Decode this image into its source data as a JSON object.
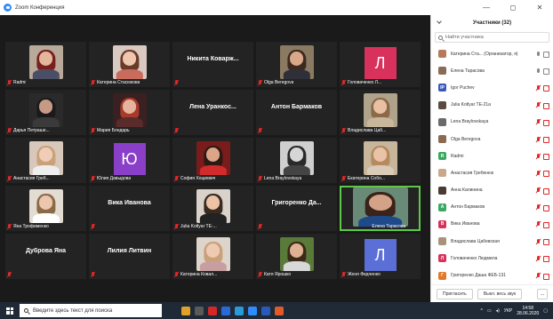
{
  "window": {
    "title": "Zoom Конференция",
    "controls": {
      "minimize": "—",
      "maximize": "◻",
      "close": "✕"
    }
  },
  "gallery": {
    "tiles": [
      {
        "name": "Radmi",
        "kind": "photo",
        "bg": "#b8a99a",
        "skin": "#e3b79b",
        "hair": "#7a1f1f",
        "torso": "#4a4f66"
      },
      {
        "name": "Катерина Стасюкова",
        "kind": "photo",
        "bg": "#d9c9c0",
        "skin": "#efc7b0",
        "hair": "#6b3b2a",
        "torso": "#c96b5d"
      },
      {
        "name": "Никита Коварж...",
        "kind": "name"
      },
      {
        "name": "Olga Beregova",
        "kind": "photo",
        "bg": "#8a7a62",
        "skin": "#d9a889",
        "hair": "#3d2a1f",
        "torso": "#2f2f3a"
      },
      {
        "name": "Головаченко Л...",
        "kind": "letter",
        "letter": "Л",
        "color": "#d8315b"
      },
      {
        "name": "Дарья Петраше...",
        "kind": "photo",
        "bg": "#2a2a2a",
        "skin": "#c79a86",
        "hair": "#1a1a1a",
        "torso": "#3a3a3a"
      },
      {
        "name": "Мария Бондарь",
        "kind": "photo",
        "bg": "#3a2020",
        "skin": "#e6b49e",
        "hair": "#a83a2a",
        "torso": "#5a2b2b"
      },
      {
        "name": "Лена Уранкос...",
        "kind": "name"
      },
      {
        "name": "Антон Бармаков",
        "kind": "name"
      },
      {
        "name": "Владислава Цаб...",
        "kind": "photo",
        "bg": "#b0a38c",
        "skin": "#e8c0a4",
        "hair": "#8c6a48",
        "torso": "#c9b79c"
      },
      {
        "name": "Анастасия Греб...",
        "kind": "photo",
        "bg": "#d8c8bc",
        "skin": "#f0cdb8",
        "hair": "#caa27a",
        "torso": "#eeeeee"
      },
      {
        "name": "Юлия Давыдова",
        "kind": "letter",
        "letter": "Ю",
        "color": "#8a3fc9"
      },
      {
        "name": "София Хоцкевич",
        "kind": "photo",
        "bg": "#7a1c1c",
        "skin": "#dca488",
        "hair": "#2a1a14",
        "torso": "#d22b2b"
      },
      {
        "name": "Lena Braylovskaya",
        "kind": "photo",
        "bg": "#cfcfcf",
        "skin": "#d6d6d6",
        "hair": "#2a2a2a",
        "torso": "#444444"
      },
      {
        "name": "Екатерина Собо...",
        "kind": "photo",
        "bg": "#c7b59c",
        "skin": "#e9c3a8",
        "hair": "#b58a5c",
        "torso": "#d9cbb8"
      },
      {
        "name": "Яна Трофименко",
        "kind": "photo",
        "bg": "#e2dcd2",
        "skin": "#ecc7ad",
        "hair": "#8b6a4a",
        "torso": "#ffffff"
      },
      {
        "name": "Вика Иванова",
        "kind": "name"
      },
      {
        "name": "Julia Kotlyar TE-...",
        "kind": "photo",
        "bg": "#d9d2ca",
        "skin": "#ecc3a6",
        "hair": "#3a2a20",
        "torso": "#222222"
      },
      {
        "name": "Григоренко Да...",
        "kind": "name"
      },
      {
        "name": "Елена Тарасова",
        "kind": "photo",
        "bg": "#6a8a78",
        "skin": "#d3a287",
        "hair": "#3a2318",
        "torso": "#1e4a8a",
        "speaking": true
      },
      {
        "name": "Дуброва Яна",
        "kind": "name"
      },
      {
        "name": "Лилия Литвин",
        "kind": "name"
      },
      {
        "name": "Катерина Ковал...",
        "kind": "photo",
        "bg": "#ddd4cc",
        "skin": "#efcab2",
        "hair": "#caa07a",
        "torso": "#c79fa0"
      },
      {
        "name": "Катя Ярошко",
        "kind": "photo",
        "bg": "#5a7a3a",
        "skin": "#e0b294",
        "hair": "#3a2a18",
        "torso": "#d8d8d8"
      },
      {
        "name": "Женя Федченко",
        "kind": "letter",
        "letter": "Л",
        "color": "#5b6fd6"
      }
    ]
  },
  "panel": {
    "title": "Участники (32)",
    "search_placeholder": "Найти участника",
    "participants": [
      {
        "name": "Катерина Ста... (Организатор, я)",
        "avatar": "photo",
        "color": "#b67a5a",
        "mic_muted": false,
        "cam_off": false
      },
      {
        "name": "Елена Тарасова",
        "avatar": "photo",
        "color": "#8a6a58",
        "mic_muted": false,
        "cam_off": false
      },
      {
        "name": "Igor Puchev",
        "avatar": "letter",
        "letter": "IP",
        "color": "#3a58b8",
        "mic_muted": true,
        "cam_off": true
      },
      {
        "name": "Julia Kotlyar TE-21a",
        "avatar": "photo",
        "color": "#5a4a40",
        "mic_muted": true,
        "cam_off": true
      },
      {
        "name": "Lena Braylovskaya",
        "avatar": "photo",
        "color": "#6a6a6a",
        "mic_muted": true,
        "cam_off": true
      },
      {
        "name": "Olga Beregova",
        "avatar": "photo",
        "color": "#8a6a52",
        "mic_muted": true,
        "cam_off": true
      },
      {
        "name": "Radmi",
        "avatar": "letter",
        "letter": "R",
        "color": "#3aa860",
        "mic_muted": true,
        "cam_off": true
      },
      {
        "name": "Анастасия Гребенюк",
        "avatar": "photo",
        "color": "#c9a88c",
        "mic_muted": true,
        "cam_off": true
      },
      {
        "name": "Анна Калинина",
        "avatar": "photo",
        "color": "#4a3a34",
        "mic_muted": true,
        "cam_off": true
      },
      {
        "name": "Антон Бармаков",
        "avatar": "letter",
        "letter": "А",
        "color": "#3aa860",
        "mic_muted": true,
        "cam_off": true
      },
      {
        "name": "Вика Иванова",
        "avatar": "letter",
        "letter": "В",
        "color": "#d8315b",
        "mic_muted": true,
        "cam_off": true
      },
      {
        "name": "Владислава Цабевская",
        "avatar": "photo",
        "color": "#a8927a",
        "mic_muted": true,
        "cam_off": true
      },
      {
        "name": "Головаченко Людмила",
        "avatar": "letter",
        "letter": "Л",
        "color": "#d8315b",
        "mic_muted": true,
        "cam_off": true
      },
      {
        "name": "Григоренко Даша ФЕБ-131",
        "avatar": "letter",
        "letter": "Г",
        "color": "#e07a2a",
        "mic_muted": true,
        "cam_off": true
      }
    ],
    "invite_label": "Пригласить",
    "mute_all_label": "Выкл. весь звук",
    "more_label": "..."
  },
  "taskbar": {
    "search_placeholder": "Введите здесь текст для поиска",
    "apps": [
      {
        "name": "chrome-app",
        "color": "#e0a12a"
      },
      {
        "name": "media-app",
        "color": "#5a5a5a"
      },
      {
        "name": "opera-app",
        "color": "#d62828"
      },
      {
        "name": "files-app",
        "color": "#2a6ad6"
      },
      {
        "name": "edge-app",
        "color": "#2a9ad6"
      },
      {
        "name": "zoom-app",
        "color": "#2d8cff"
      },
      {
        "name": "word-app",
        "color": "#2a5ab8"
      },
      {
        "name": "paint-app",
        "color": "#e05a2a"
      }
    ],
    "language": "УКР",
    "time": "14:58",
    "date": "28.06.2020"
  }
}
